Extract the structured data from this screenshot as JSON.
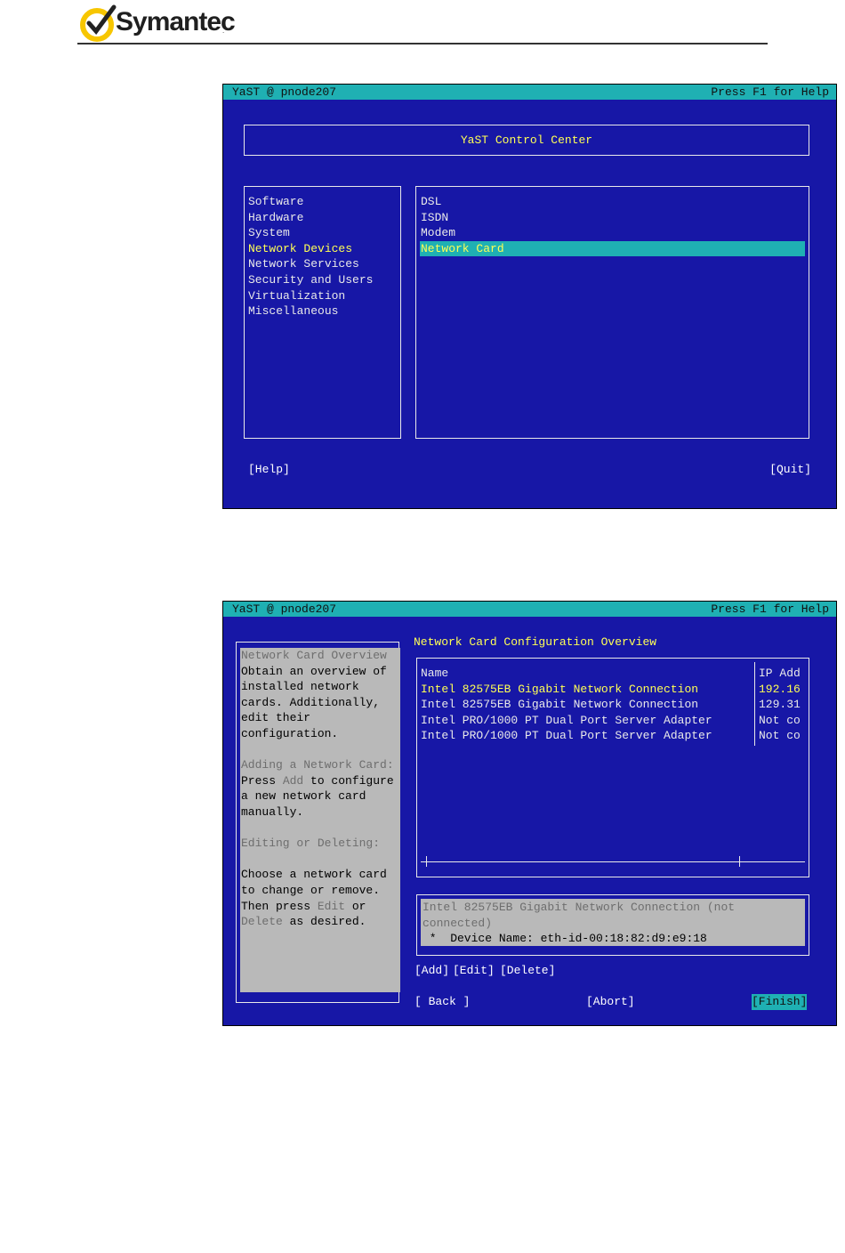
{
  "brand": {
    "name": "Symantec",
    "tm": "."
  },
  "term1": {
    "title_left": "YaST @ pnode207",
    "title_right": "Press F1 for Help",
    "header": "YaST Control Center",
    "categories": [
      "Software",
      "Hardware",
      "System",
      "Network Devices",
      "Network Services",
      "Security and Users",
      "Virtualization",
      "Miscellaneous"
    ],
    "modules": [
      "DSL",
      "ISDN",
      "Modem",
      "Network Card"
    ],
    "help_btn": "[Help]",
    "quit_btn": "[Quit]"
  },
  "term2": {
    "title_left": "YaST @ pnode207",
    "title_right": "Press F1 for Help",
    "heading": "Network Card Configuration Overview",
    "help": {
      "h1": "Network Card Overview",
      "p1": "Obtain an overview of installed network cards. Additionally, edit their configuration.",
      "h2": "Adding a Network Card:",
      "p2a": "Press ",
      "p2kw": "Add",
      "p2b": " to configure a new network card manually.",
      "h3": "Editing or Deleting:",
      "p3a": "Choose a network card to change or remove. Then press ",
      "p3kw1": "Edit",
      "p3mid": " or ",
      "p3kw2": "Delete",
      "p3b": " as desired."
    },
    "table": {
      "col_name": "Name",
      "col_ip": "IP Add",
      "rows": [
        {
          "name": "Intel 82575EB Gigabit Network Connection",
          "ip": "192.16"
        },
        {
          "name": "Intel 82575EB Gigabit Network Connection",
          "ip": "129.31"
        },
        {
          "name": "Intel PRO/1000 PT Dual Port Server Adapter",
          "ip": "Not co"
        },
        {
          "name": "Intel PRO/1000 PT Dual Port Server Adapter",
          "ip": "Not co"
        }
      ]
    },
    "detail_line1": "Intel 82575EB Gigabit Network Connection (not",
    "detail_line2": "connected)",
    "detail_line3": " *  Device Name: eth-id-00:18:82:d9:e9:18",
    "add_btn": "[Add]",
    "edit_btn": "[Edit]",
    "delete_btn": "[Delete]",
    "back_btn": "[ Back ]",
    "abort_btn": "[Abort]",
    "finish_btn": "[Finish]"
  }
}
